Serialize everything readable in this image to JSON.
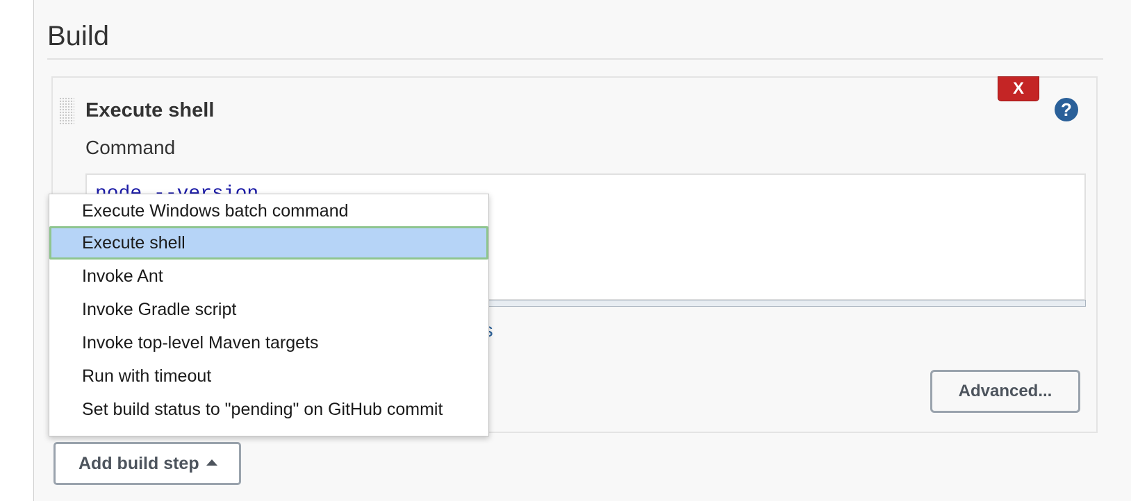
{
  "section": {
    "title": "Build"
  },
  "build_step": {
    "title": "Execute shell",
    "delete_label": "X",
    "help_label": "?",
    "command_label": "Command",
    "command_value": "node --version",
    "env_link_text": "es",
    "advanced_label": "Advanced..."
  },
  "add_build_step": {
    "label": "Add build step"
  },
  "dropdown": {
    "items": [
      {
        "label": "Execute Windows batch command"
      },
      {
        "label": "Execute shell"
      },
      {
        "label": "Invoke Ant"
      },
      {
        "label": "Invoke Gradle script"
      },
      {
        "label": "Invoke top-level Maven targets"
      },
      {
        "label": "Run with timeout"
      },
      {
        "label": "Set build status to \"pending\" on GitHub commit"
      }
    ],
    "selected_index": 1
  },
  "colors": {
    "delete_red": "#c42525",
    "help_blue": "#2a6099",
    "selected_bg": "#b6d4f7",
    "selected_border": "#8fc58f"
  }
}
